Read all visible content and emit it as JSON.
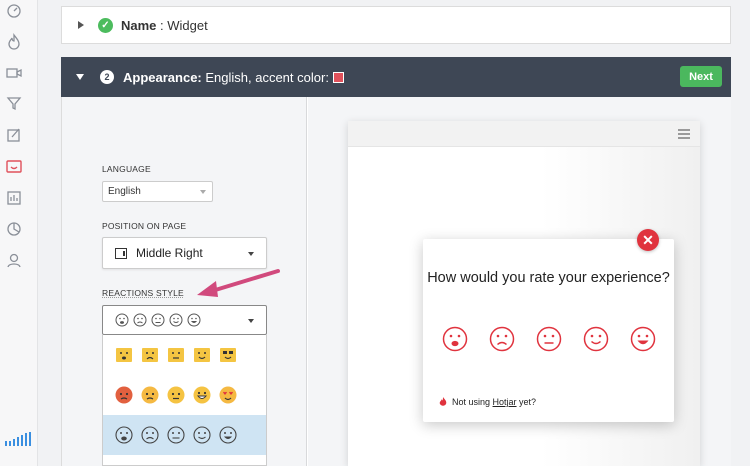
{
  "rail": {
    "items": [
      {
        "name": "dashboard-icon"
      },
      {
        "name": "heatmaps-icon"
      },
      {
        "name": "recordings-icon"
      },
      {
        "name": "funnels-icon"
      },
      {
        "name": "forms-icon"
      },
      {
        "name": "incoming-feedback-icon"
      },
      {
        "name": "polls-icon"
      },
      {
        "name": "surveys-icon"
      },
      {
        "name": "recruiters-icon"
      }
    ],
    "active_color": "#e0515b"
  },
  "step1": {
    "title": "Name",
    "value": " : Widget"
  },
  "step2": {
    "number": "2",
    "title": "Appearance:",
    "value": " English, accent color:",
    "accent_color": "#e0515b",
    "next_label": "Next"
  },
  "settings": {
    "language_label": "LANGUAGE",
    "language_value": "English",
    "position_label": "POSITION ON PAGE",
    "position_value": "Middle Right",
    "reactions_label": "REACTIONS STYLE"
  },
  "preview": {
    "question": "How would you rate your experience?",
    "close_label": "✕",
    "footer_prefix": "Not using ",
    "footer_link": "Hotjar",
    "footer_suffix": " yet?"
  }
}
